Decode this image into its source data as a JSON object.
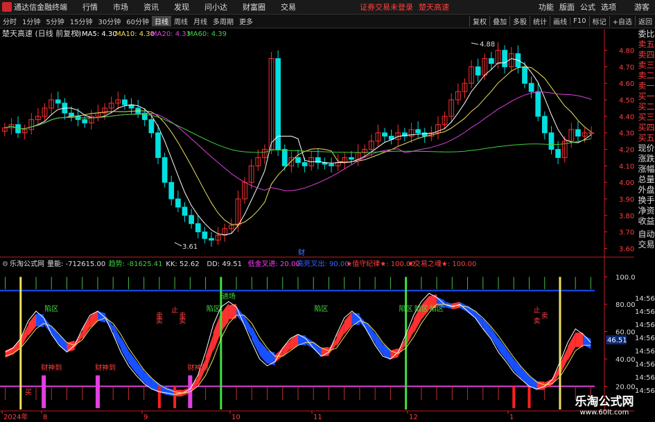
{
  "menubar": {
    "app_title": "通达信金融终端",
    "items": [
      "行情",
      "市场",
      "资讯",
      "发现",
      "问小达",
      "财富圈",
      "交易"
    ],
    "warning": "证券交易未登录",
    "stock": "楚天高速",
    "right_items": [
      "功能",
      "版面",
      "公式",
      "选项",
      "游客"
    ]
  },
  "toolbar": {
    "periods": [
      "分时",
      "1分钟",
      "5分钟",
      "15分钟",
      "30分钟",
      "60分钟",
      "日线",
      "周线",
      "月线",
      "多周期",
      "更多"
    ],
    "active": "日线",
    "right_items": [
      "复权",
      "叠加",
      "多股",
      "统计",
      "画线",
      "F10",
      "标记",
      "+自选",
      "返回"
    ]
  },
  "main_chart": {
    "title": "楚天高速 (日线 前复权)",
    "ma_labels": [
      {
        "text": "MA5: 4.30",
        "color": "#ffffff"
      },
      {
        "text": "MA10: 4.30",
        "color": "#f0e060"
      },
      {
        "text": "MA20: 4.33",
        "color": "#e040e0"
      },
      {
        "text": "MA60: 4.39",
        "color": "#40d040"
      }
    ],
    "high_label": "4.88",
    "low_label": "3.61",
    "fin_marker": "财"
  },
  "chart_data": [
    {
      "type": "candlestick",
      "title": "楚天高速 (日线 前复权)",
      "y_ticks": [
        3.6,
        3.7,
        3.8,
        3.9,
        4.0,
        4.1,
        4.2,
        4.3,
        4.4,
        4.5,
        4.6,
        4.7,
        4.8
      ],
      "ylim": [
        3.56,
        4.92
      ],
      "x_ticks": [
        "2024年",
        "8",
        "9",
        "10",
        "11",
        "12",
        "1"
      ],
      "close": [
        4.33,
        4.35,
        4.3,
        4.32,
        4.38,
        4.4,
        4.45,
        4.5,
        4.48,
        4.42,
        4.4,
        4.38,
        4.36,
        4.4,
        4.42,
        4.45,
        4.48,
        4.5,
        4.47,
        4.45,
        4.42,
        4.38,
        4.3,
        4.15,
        4.0,
        3.9,
        3.85,
        3.8,
        3.75,
        3.7,
        3.66,
        3.65,
        3.68,
        3.72,
        3.74,
        3.9,
        4.0,
        4.1,
        4.15,
        4.2,
        4.75,
        4.2,
        4.1,
        4.15,
        4.12,
        4.1,
        4.15,
        4.12,
        4.11,
        4.1,
        4.12,
        4.15,
        4.14,
        4.18,
        4.2,
        4.25,
        4.3,
        4.28,
        4.26,
        4.3,
        4.28,
        4.32,
        4.3,
        4.28,
        4.3,
        4.35,
        4.4,
        4.5,
        4.55,
        4.6,
        4.7,
        4.65,
        4.75,
        4.72,
        4.8,
        4.7,
        4.78,
        4.7,
        4.6,
        4.55,
        4.4,
        4.3,
        4.2,
        4.15,
        4.25,
        4.32,
        4.28,
        4.3,
        4.3
      ],
      "ma_latest": {
        "MA5": 4.3,
        "MA10": 4.3,
        "MA20": 4.33,
        "MA60": 4.39
      },
      "high": 4.88,
      "low": 3.61
    },
    {
      "type": "indicator",
      "title": "乐淘公式网",
      "labels": [
        {
          "text": "量能: -712615.00",
          "color": "#e0e0e0"
        },
        {
          "text": "趋势: -81625.41",
          "color": "#40d040"
        },
        {
          "text": "KK: 52.62",
          "color": "#e0e0e0"
        },
        {
          "text": "DD: 49.51",
          "color": "#e0e0e0"
        },
        {
          "text": "低金叉进: 20.00",
          "color": "#ff40ff"
        },
        {
          "text": "高死叉出: 90.00",
          "color": "#4060ff"
        },
        {
          "text": "★值守纪律★: 100.00",
          "color": "#ff4040"
        },
        {
          "text": "★交易之魂★: 100.00",
          "color": "#ff4040"
        }
      ],
      "y_ticks": [
        20.0,
        40.0,
        60.0,
        80.0,
        100.0
      ],
      "ylim": [
        3,
        113
      ],
      "current_value": "46.51",
      "annotations": [
        "财神到",
        "财神到",
        "财神到",
        "陷区",
        "陷区",
        "陷区",
        "陷区",
        "陷区",
        "陷区",
        "卖",
        "卖",
        "卖",
        "止",
        "卖",
        "卖",
        "止",
        "卖",
        "买",
        "进场"
      ],
      "kk": [
        45,
        48,
        55,
        68,
        75,
        70,
        58,
        50,
        45,
        50,
        62,
        72,
        75,
        70,
        58,
        45,
        35,
        28,
        22,
        18,
        16,
        15,
        14,
        15,
        18,
        28,
        45,
        65,
        78,
        82,
        78,
        65,
        52,
        40,
        35,
        38,
        48,
        55,
        58,
        55,
        48,
        42,
        45,
        58,
        70,
        75,
        70,
        60,
        50,
        42,
        40,
        45,
        58,
        72,
        82,
        88,
        85,
        80,
        78,
        80,
        75,
        70,
        62,
        55,
        45,
        38,
        30,
        25,
        20,
        18,
        20,
        25,
        38,
        52,
        62,
        58,
        52
      ],
      "dd": [
        42,
        44,
        48,
        55,
        62,
        66,
        64,
        58,
        52,
        50,
        54,
        62,
        68,
        70,
        66,
        58,
        48,
        40,
        32,
        26,
        21,
        18,
        16,
        15,
        16,
        20,
        28,
        40,
        55,
        66,
        72,
        72,
        66,
        56,
        48,
        42,
        42,
        46,
        50,
        52,
        52,
        48,
        46,
        48,
        56,
        64,
        68,
        66,
        60,
        52,
        46,
        44,
        48,
        56,
        66,
        74,
        80,
        80,
        79,
        79,
        78,
        75,
        70,
        64,
        57,
        49,
        41,
        34,
        28,
        23,
        21,
        22,
        27,
        36,
        46,
        50,
        50
      ]
    }
  ],
  "indicator_panel": {
    "right_labels": [
      "自动",
      "交易"
    ],
    "time_labels": [
      "14:56",
      "14:56",
      "14:56",
      "14:56",
      "14:56",
      "14:56",
      "14:56",
      "14:56"
    ]
  },
  "sidebar": [
    "委比",
    "卖五",
    "卖四",
    "卖三",
    "卖二",
    "卖一",
    "买一",
    "买二",
    "买三",
    "买四",
    "买五",
    "现价",
    "涨跌",
    "涨幅",
    "总量",
    "外盘",
    "换手",
    "净资",
    "收益"
  ],
  "watermark": {
    "line1": "乐淘公式网",
    "line2": "www.60lt.com"
  },
  "colors": {
    "bg": "#000000",
    "up": "#ff3030",
    "down": "#00e0e0",
    "axis": "#ff2020",
    "grid": "#666666",
    "blue_band": "#1850ff",
    "red_band": "#ff3030"
  }
}
